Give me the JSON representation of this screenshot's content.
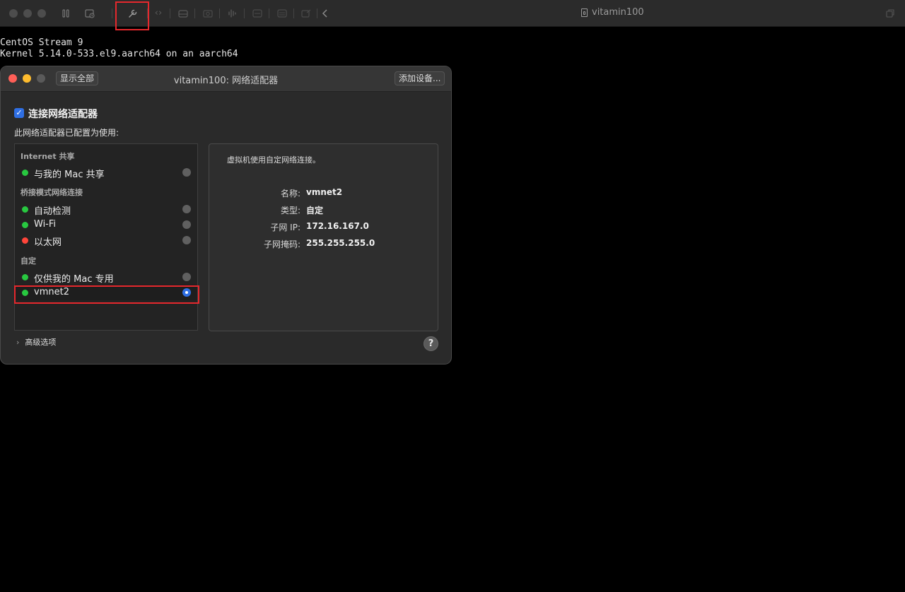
{
  "window": {
    "title": "vitamin100"
  },
  "console": {
    "lines": [
      "CentOS Stream 9",
      "Kernel 5.14.0-533.el9.aarch64 on an aarch64"
    ]
  },
  "toolbar": {
    "icons": [
      "pause-icon",
      "snapshot-icon",
      "wrench-icon",
      "code-icon",
      "drive-icon",
      "camera-icon",
      "audio-icon",
      "usb-icon",
      "printer-icon",
      "share-icon",
      "back-icon"
    ]
  },
  "dialog": {
    "title": "vitamin100: 网络适配器",
    "show_all": "显示全部",
    "add_device": "添加设备...",
    "connect_label": "连接网络适配器",
    "connect_checked": true,
    "configured_for": "此网络适配器已配置为使用:",
    "groups": [
      {
        "header": "Internet 共享",
        "items": [
          {
            "label": "与我的 Mac 共享",
            "status": "green",
            "selected": false
          }
        ]
      },
      {
        "header": "桥接模式网络连接",
        "items": [
          {
            "label": "自动检测",
            "status": "green",
            "selected": false
          },
          {
            "label": "Wi-Fi",
            "status": "green",
            "selected": false
          },
          {
            "label": "以太网",
            "status": "red",
            "selected": false
          }
        ]
      },
      {
        "header": "自定",
        "items": [
          {
            "label": "仅供我的 Mac 专用",
            "status": "green",
            "selected": false
          },
          {
            "label": "vmnet2",
            "status": "green",
            "selected": true
          }
        ]
      }
    ],
    "detail": {
      "description": "虚拟机使用自定网络连接。",
      "fields": [
        {
          "key": "名称:",
          "value": "vmnet2"
        },
        {
          "key": "类型:",
          "value": "自定"
        },
        {
          "key": "子网 IP:",
          "value": "172.16.167.0"
        },
        {
          "key": "子网掩码:",
          "value": "255.255.255.0"
        }
      ]
    },
    "advanced": "高级选项",
    "help": "?"
  },
  "colors": {
    "green": "#28c840",
    "red": "#ff453a",
    "accent": "#2f6fe4",
    "highlight": "#e5282d"
  }
}
